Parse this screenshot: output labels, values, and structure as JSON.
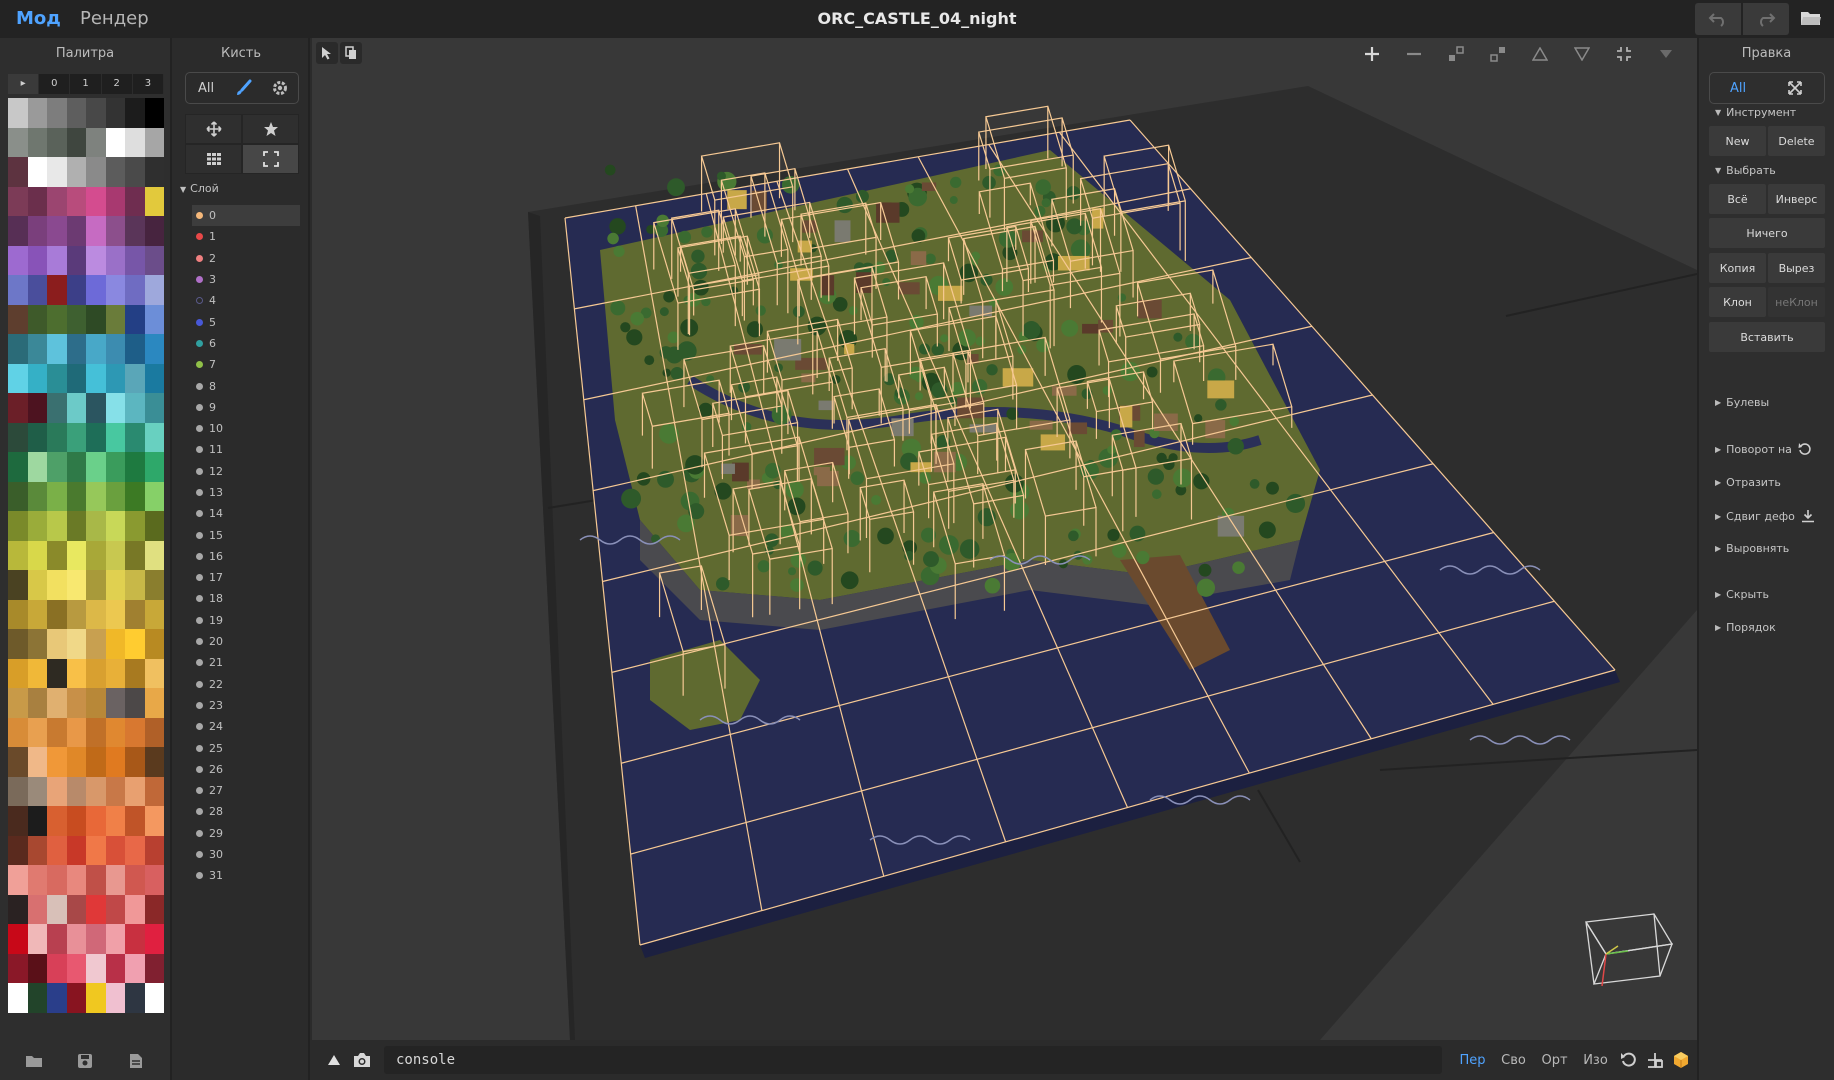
{
  "app": {
    "mode_tabs": [
      "Мод",
      "Рендер"
    ],
    "document_title": "ORC_CASTLE_04_night",
    "undo_icon": "undo-icon",
    "redo_icon": "redo-icon",
    "folder_icon": "folder-icon"
  },
  "palette": {
    "title": "Палитра",
    "tabs": [
      "▸",
      "0",
      "1",
      "2",
      "3"
    ],
    "selected_index": 253,
    "colors": [
      "#c8c8c8",
      "#9a9a9a",
      "#7d7d7d",
      "#5e5e5e",
      "#484848",
      "#333333",
      "#1c1c1c",
      "#000000",
      "#8a8f8a",
      "#6f776f",
      "#5a625a",
      "#3f463f",
      "#7e827e",
      "#ffffff",
      "#dedede",
      "#a6a6a6",
      "#5d3340",
      "#ffffff",
      "#e8e8e8",
      "#b0b0b0",
      "#8a8a8a",
      "#5c5c5c",
      "#4a4a4a",
      "#2f2f2f",
      "#7c3b57",
      "#6b2f4c",
      "#9b4570",
      "#b84c7c",
      "#d44c8f",
      "#a83970",
      "#6f2d50",
      "#e2c93c",
      "#572f55",
      "#7a3f7c",
      "#8a4990",
      "#6c3a72",
      "#c66bc2",
      "#8c4f8c",
      "#5a3559",
      "#47243f",
      "#9d6ad0",
      "#8853b8",
      "#a87bd8",
      "#5a3a7a",
      "#bb8be0",
      "#9a70c8",
      "#7756a8",
      "#6b4d8a",
      "#6d77c8",
      "#4a4e9c",
      "#8b1d1d",
      "#3c3f88",
      "#6d6ad8",
      "#8a88e0",
      "#6f6cc2",
      "#9ea8dc",
      "#5e3e2e",
      "#3e5a2a",
      "#4d6e2f",
      "#3e6030",
      "#2e4a25",
      "#6a7c3a",
      "#233f85",
      "#6c8ed8",
      "#2b6b78",
      "#3b8898",
      "#5ec2dc",
      "#2d6d8a",
      "#48a8c8",
      "#3c8cb0",
      "#1e5e88",
      "#2b88c0",
      "#60d2e6",
      "#35b0c6",
      "#2a8e96",
      "#1f6a78",
      "#45c0d8",
      "#2d98b4",
      "#5aa6b8",
      "#1a7aa0",
      "#6b1f28",
      "#4d1320",
      "#3a7070",
      "#6ccac8",
      "#2b5560",
      "#86e0e8",
      "#5cb6c0",
      "#3a8e96",
      "#2c4a3a",
      "#1f5e48",
      "#2a7a5a",
      "#3aa07a",
      "#1e6e58",
      "#48c8a0",
      "#2a8a70",
      "#68d0c0",
      "#1e6a3e",
      "#9ed8a0",
      "#4ea068",
      "#2f7a48",
      "#6ad08a",
      "#3a9c5c",
      "#1e7a40",
      "#2ea86a",
      "#3a5e2a",
      "#5a8a3a",
      "#7ab048",
      "#4a7a2e",
      "#96c85a",
      "#6aa03e",
      "#3c7a24",
      "#86d068",
      "#7a8a2a",
      "#9aac3a",
      "#b8c84a",
      "#6a7a26",
      "#a8b848",
      "#c8d858",
      "#8a9a30",
      "#5a6a1e",
      "#b8b83a",
      "#d8d84a",
      "#8a8a2a",
      "#e8e860",
      "#a8a838",
      "#c8c850",
      "#787826",
      "#e0e080",
      "#4a4222",
      "#d8c848",
      "#f2e060",
      "#f8e870",
      "#a89a3a",
      "#e0d050",
      "#c8b848",
      "#8a7e2e",
      "#a88a2a",
      "#c8a838",
      "#8a7024",
      "#b89a40",
      "#dcb848",
      "#ecc850",
      "#a08030",
      "#c8a838",
      "#6e5a2a",
      "#8c7436",
      "#e8c878",
      "#f0d888",
      "#c8a050",
      "#f0b828",
      "#ffcc30",
      "#b88a22",
      "#d89e28",
      "#f0b838",
      "#2e2a22",
      "#f8c048",
      "#d8a030",
      "#e8b038",
      "#a87a20",
      "#f0c060",
      "#c89a48",
      "#a88040",
      "#e0b070",
      "#c89048",
      "#b88838",
      "#6a6262",
      "#4c4848",
      "#e8a848",
      "#d88c38",
      "#e8a050",
      "#c87a30",
      "#e89848",
      "#c07028",
      "#e08830",
      "#d87830",
      "#b06028",
      "#6a4a2a",
      "#f0b888",
      "#f09838",
      "#e08828",
      "#c06a18",
      "#e07a20",
      "#a85818",
      "#5a3a1e",
      "#7a6a5a",
      "#9a8a7a",
      "#e8a478",
      "#b88a6a",
      "#d8986a",
      "#c87848",
      "#e8a070",
      "#c06838",
      "#4a2a1e",
      "#1c1c1c",
      "#d86030",
      "#c84c20",
      "#e86838",
      "#f08048",
      "#c05428",
      "#f49860",
      "#5a2a1e",
      "#a84830",
      "#e06040",
      "#c83828",
      "#f07848",
      "#d85038",
      "#e86848",
      "#b84030",
      "#f0a098",
      "#e07a70",
      "#d86a60",
      "#e8887e",
      "#c05048",
      "#e89890",
      "#d05850",
      "#d86060",
      "#2a2222",
      "#d87070",
      "#d8c0b8",
      "#a84848",
      "#e03838",
      "#c04848",
      "#f09898",
      "#8a2828",
      "#c80818",
      "#f0b8b8",
      "#b84050",
      "#e89098",
      "#d06878",
      "#f0a0a8",
      "#c83040",
      "#e02040",
      "#8a1828",
      "#5a1018",
      "#d84058",
      "#e85870",
      "#f0c8d0",
      "#b83048",
      "#f0a0b0",
      "#802030",
      "#ffffff",
      "#22442a",
      "#2a3e8a",
      "#881420",
      "#f0c820",
      "#f0c0d0",
      "#2e3642",
      "#ffffff"
    ],
    "bottom_icons": [
      "folder-open-icon",
      "save-icon",
      "file-icon"
    ]
  },
  "brush": {
    "title": "Кисть",
    "filter_label": "All",
    "tools": [
      "move-icon",
      "star-icon",
      "grid-icon",
      "frame-icon"
    ],
    "layer_header": "Слой",
    "layers": [
      {
        "label": "0",
        "color": "#f5b87a"
      },
      {
        "label": "1",
        "color": "#e84848"
      },
      {
        "label": "2",
        "color": "#f08080"
      },
      {
        "label": "3",
        "color": "#b070c8"
      },
      {
        "label": "4",
        "color": "#4a4a9a"
      },
      {
        "label": "5",
        "color": "#4858d8"
      },
      {
        "label": "6",
        "color": "#30a0a0"
      },
      {
        "label": "7",
        "color": "#90c048"
      },
      {
        "label": "8",
        "color": "#a8a8a8"
      },
      {
        "label": "9",
        "color": "#a8a8a8"
      },
      {
        "label": "10",
        "color": "#a8a8a8"
      },
      {
        "label": "11",
        "color": "#a8a8a8"
      },
      {
        "label": "12",
        "color": "#a8a8a8"
      },
      {
        "label": "13",
        "color": "#a8a8a8"
      },
      {
        "label": "14",
        "color": "#a8a8a8"
      },
      {
        "label": "15",
        "color": "#a8a8a8"
      },
      {
        "label": "16",
        "color": "#a8a8a8"
      },
      {
        "label": "17",
        "color": "#a8a8a8"
      },
      {
        "label": "18",
        "color": "#a8a8a8"
      },
      {
        "label": "19",
        "color": "#a8a8a8"
      },
      {
        "label": "20",
        "color": "#a8a8a8"
      },
      {
        "label": "21",
        "color": "#a8a8a8"
      },
      {
        "label": "22",
        "color": "#a8a8a8"
      },
      {
        "label": "23",
        "color": "#a8a8a8"
      },
      {
        "label": "24",
        "color": "#a8a8a8"
      },
      {
        "label": "25",
        "color": "#a8a8a8"
      },
      {
        "label": "26",
        "color": "#a8a8a8"
      },
      {
        "label": "27",
        "color": "#a8a8a8"
      },
      {
        "label": "28",
        "color": "#a8a8a8"
      },
      {
        "label": "29",
        "color": "#a8a8a8"
      },
      {
        "label": "30",
        "color": "#a8a8a8"
      },
      {
        "label": "31",
        "color": "#a8a8a8"
      }
    ]
  },
  "viewport": {
    "toolbar_icons": [
      "zoom-in-icon",
      "zoom-out-icon",
      "shrink-icon",
      "expand-icon",
      "triangle-up-icon",
      "triangle-down-icon",
      "fit-icon",
      "dropdown-icon"
    ],
    "console_placeholder": "console",
    "view_modes": [
      "Пер",
      "Сво",
      "Орт",
      "Изо"
    ],
    "active_view_mode": "Пер",
    "colors": {
      "water": "#262b52",
      "floor": "#2c2c2c",
      "wire": "#f6c994",
      "grass": "#6d7a36"
    }
  },
  "edit": {
    "title": "Правка",
    "filter_label": "All",
    "sections": {
      "tool": "Инструмент",
      "select": "Выбрать",
      "boolean": "Булевы",
      "rotate": "Поворот на",
      "mirror": "Отразить",
      "shift": "Сдвиг дефо",
      "align": "Выровнять",
      "hide": "Скрыть",
      "order": "Порядок"
    },
    "buttons": {
      "new": "New",
      "delete": "Delete",
      "all": "Всё",
      "invert": "Инверс",
      "none": "Ничего",
      "copy": "Копия",
      "cut": "Вырез",
      "clone": "Клон",
      "unclone": "неКлон",
      "paste": "Вставить"
    }
  }
}
